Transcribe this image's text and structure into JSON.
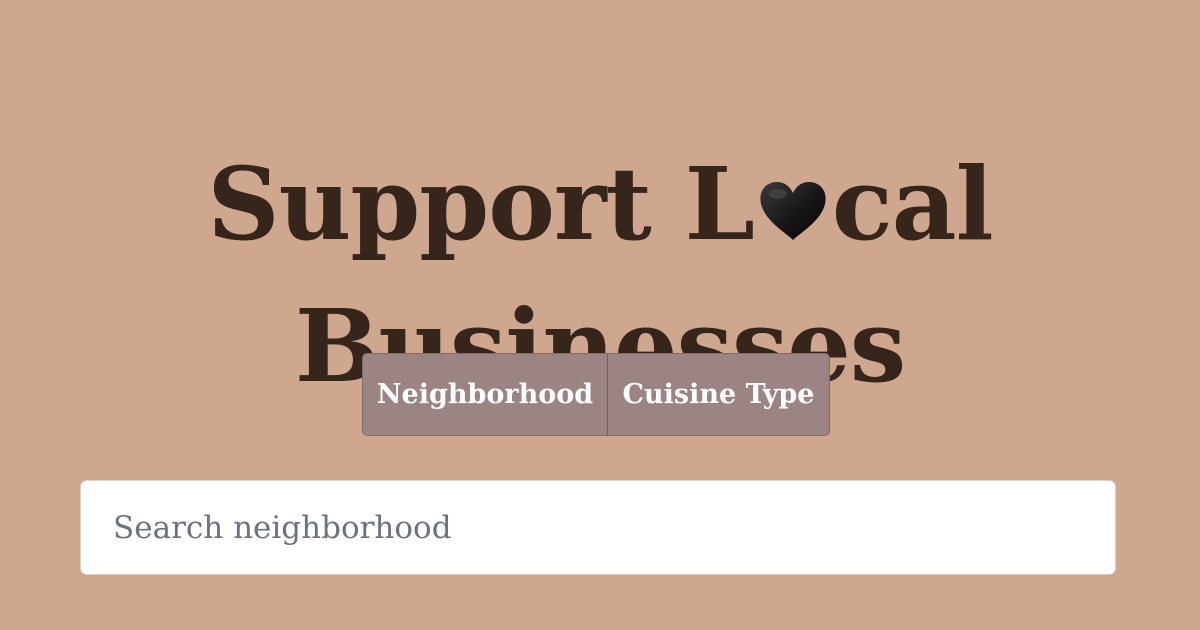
{
  "title": {
    "line1_before": "Support L",
    "heart_icon": "black-heart-icon",
    "line1_after": "cal",
    "line2": "Businesses"
  },
  "filter_toggle": {
    "options": [
      {
        "label": "Neighborhood",
        "active": false
      },
      {
        "label": "Cuisine Type",
        "active": false
      }
    ]
  },
  "search": {
    "placeholder": "Search neighborhood",
    "value": ""
  },
  "colors": {
    "background": "#cfa78f",
    "title_text": "#35251b",
    "toggle_background": "#9b8584",
    "toggle_text": "#ffffff",
    "search_background": "#ffffff",
    "search_placeholder": "#6b7280"
  }
}
